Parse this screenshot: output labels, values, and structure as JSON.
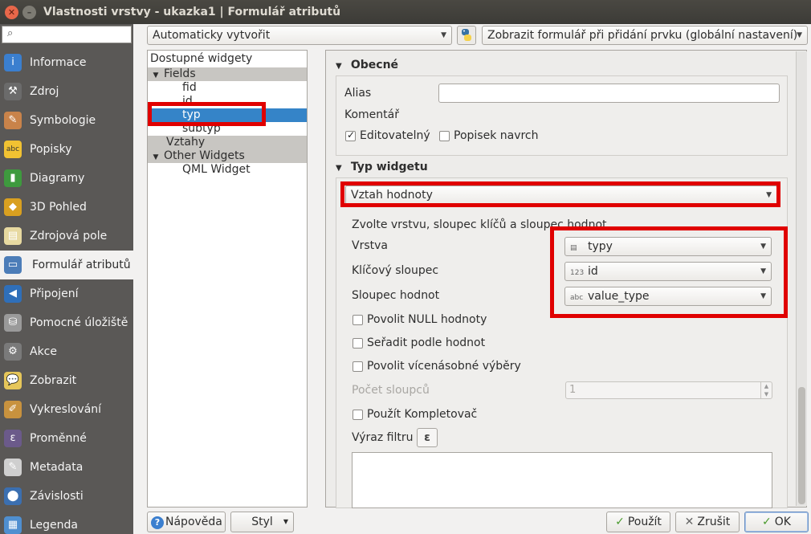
{
  "window": {
    "title": "Vlastnosti vrstvy - ukazka1 | Formulář atributů",
    "close_glyph": "✕",
    "max_glyph": "–"
  },
  "search": {
    "placeholder": "",
    "icon": "search-icon"
  },
  "sidebar": {
    "items": [
      {
        "label": "Informace",
        "icon": "info-icon",
        "color": "#3b7fcf",
        "glyph": "i"
      },
      {
        "label": "Zdroj",
        "icon": "wrench-icon",
        "color": "#6b6b6b",
        "glyph": "⚒"
      },
      {
        "label": "Symbologie",
        "icon": "paintbrush-icon",
        "color": "#c9834a",
        "glyph": "✎"
      },
      {
        "label": "Popisky",
        "icon": "label-abc-icon",
        "color": "#f1c232",
        "glyph": "abc"
      },
      {
        "label": "Diagramy",
        "icon": "diagram-icon",
        "color": "#3e9a3e",
        "glyph": "▮"
      },
      {
        "label": "3D Pohled",
        "icon": "cube-icon",
        "color": "#d9a020",
        "glyph": "◆"
      },
      {
        "label": "Zdrojová pole",
        "icon": "fields-table-icon",
        "color": "#e7d9a0",
        "glyph": "▤"
      },
      {
        "label": "Formulář atributů",
        "icon": "form-icon",
        "color": "#4c7db8",
        "glyph": "▭"
      },
      {
        "label": "Připojení",
        "icon": "join-icon",
        "color": "#2f6fb9",
        "glyph": "◀"
      },
      {
        "label": "Pomocné úložiště",
        "icon": "storage-icon",
        "color": "#9a9a9a",
        "glyph": "⛁"
      },
      {
        "label": "Akce",
        "icon": "gear-icon",
        "color": "#7a7a7a",
        "glyph": "⚙"
      },
      {
        "label": "Zobrazit",
        "icon": "speech-bubble-icon",
        "color": "#e6c65a",
        "glyph": "💬"
      },
      {
        "label": "Vykreslování",
        "icon": "brush-icon",
        "color": "#c8923e",
        "glyph": "✐"
      },
      {
        "label": "Proměnné",
        "icon": "epsilon-icon",
        "color": "#6b5a8a",
        "glyph": "ε"
      },
      {
        "label": "Metadata",
        "icon": "metadata-icon",
        "color": "#cfcfcf",
        "glyph": "✎"
      },
      {
        "label": "Závislosti",
        "icon": "dependencies-icon",
        "color": "#3b6fb0",
        "glyph": "⬤"
      },
      {
        "label": "Legenda",
        "icon": "legend-icon",
        "color": "#4f8fd0",
        "glyph": "▦"
      }
    ],
    "active_index": 7
  },
  "top": {
    "layout_combo": "Automaticky vytvořit",
    "python_icon": "python-icon",
    "feature_form_combo": "Zobrazit formulář při přidání prvku (globální nastavení)"
  },
  "tree": {
    "header": "Dostupné widgety",
    "groups": [
      {
        "label": "Fields",
        "children": [
          "fid",
          "id",
          "typ",
          "subtyp"
        ]
      },
      {
        "label": "Vztahy",
        "children": []
      },
      {
        "label": "Other Widgets",
        "children": [
          "QML Widget"
        ]
      }
    ],
    "selected": "typ"
  },
  "general": {
    "heading": "Obecné",
    "alias_label": "Alias",
    "alias_value": "",
    "comment_label": "Komentář",
    "editable_label": "Editovatelný",
    "editable_checked": true,
    "label_on_top_label": "Popisek navrch",
    "label_on_top_checked": false
  },
  "widget_type": {
    "heading": "Typ widgetu",
    "selected": "Vztah hodnoty",
    "hint": "Zvolte vrstvu, sloupec klíčů a sloupec hodnot",
    "layer_label": "Vrstva",
    "layer_value": "typy",
    "key_label": "Klíčový sloupec",
    "key_value": "id",
    "key_type_icon": "123",
    "value_label": "Sloupec hodnot",
    "value_value": "value_type",
    "value_type_icon": "abc",
    "allow_null": "Povolit NULL hodnoty",
    "order_by_value": "Seřadit podle hodnot",
    "allow_multi": "Povolit vícenásobné výběry",
    "column_count_label": "Počet sloupců",
    "column_count_value": "1",
    "use_completer": "Použít Kompletovač",
    "filter_expr_label": "Výraz filtru",
    "filter_expr_button": "ε",
    "filter_expr_value": ""
  },
  "buttons": {
    "help": "Nápověda",
    "style": "Styl",
    "apply": "Použít",
    "cancel": "Zrušit",
    "ok": "OK"
  },
  "colors": {
    "highlight_red": "#e00000",
    "selection_blue": "#3584c8",
    "sidebar_bg": "#5a5856"
  }
}
